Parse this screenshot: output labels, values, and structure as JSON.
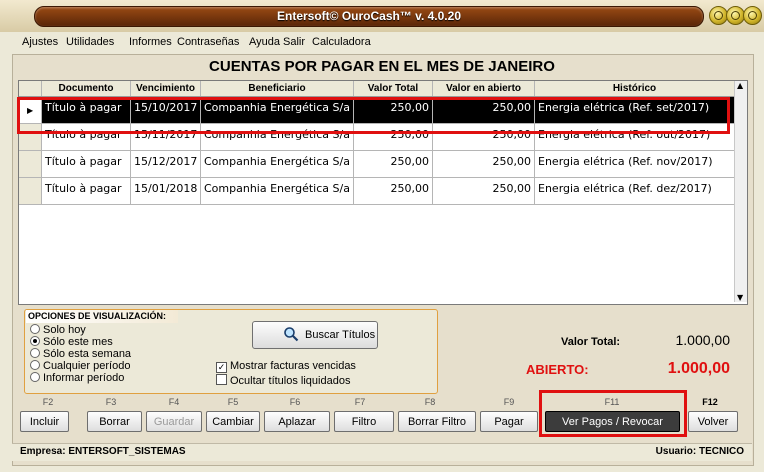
{
  "window": {
    "title": "Entersoft© OuroCash™ v. 4.0.20"
  },
  "menu": [
    "Ajustes",
    "Utilidades",
    "Informes",
    "Contraseñas",
    "Ayuda",
    "Salir",
    "Calculadora"
  ],
  "heading": "CUENTAS POR PAGAR EN EL MES DE JANEIRO",
  "table": {
    "columns": [
      "Documento",
      "Vencimiento",
      "Beneficiario",
      "Valor Total",
      "Valor en abierto",
      "Histórico"
    ],
    "rows": [
      {
        "documento": "Título à pagar",
        "vencimiento": "15/10/2017",
        "beneficiario": "Companhia Energética S/a",
        "valor_total": "250,00",
        "valor_abierto": "250,00",
        "historico": "Energia elétrica (Ref. set/2017)"
      },
      {
        "documento": "Título à pagar",
        "vencimiento": "15/11/2017",
        "beneficiario": "Companhia Energética S/a",
        "valor_total": "250,00",
        "valor_abierto": "250,00",
        "historico": "Energia elétrica (Ref. out/2017)"
      },
      {
        "documento": "Título à pagar",
        "vencimiento": "15/12/2017",
        "beneficiario": "Companhia Energética S/a",
        "valor_total": "250,00",
        "valor_abierto": "250,00",
        "historico": "Energia elétrica (Ref. nov/2017)"
      },
      {
        "documento": "Título à pagar",
        "vencimiento": "15/01/2018",
        "beneficiario": "Companhia Energética S/a",
        "valor_total": "250,00",
        "valor_abierto": "250,00",
        "historico": "Energia elétrica (Ref. dez/2017)"
      }
    ]
  },
  "options": {
    "label": "OPCIONES DE VISUALIZACIÓN:",
    "radios": [
      {
        "label": "Solo hoy",
        "checked": false
      },
      {
        "label": "Sólo este mes",
        "checked": true
      },
      {
        "label": "Sólo esta semana",
        "checked": false
      },
      {
        "label": "Cualquier período",
        "checked": false
      },
      {
        "label": "Informar período",
        "checked": false
      }
    ],
    "checkboxes": [
      {
        "label": "Mostrar facturas vencidas",
        "checked": true
      },
      {
        "label": "Ocultar títulos liquidados",
        "checked": false
      }
    ],
    "search_button": "Buscar Títulos"
  },
  "totals": {
    "total_label": "Valor Total:",
    "total_value": "1.000,00",
    "open_label": "ABIERTO:",
    "open_value": "1.000,00"
  },
  "toolbar": [
    {
      "key": "F2",
      "label": "Incluir",
      "disabled": false
    },
    {
      "key": "F3",
      "label": "Borrar",
      "disabled": false
    },
    {
      "key": "F4",
      "label": "Guardar",
      "disabled": true
    },
    {
      "key": "F5",
      "label": "Cambiar",
      "disabled": false
    },
    {
      "key": "F6",
      "label": "Aplazar",
      "disabled": false
    },
    {
      "key": "F7",
      "label": "Filtro",
      "disabled": false
    },
    {
      "key": "F8",
      "label": "Borrar Filtro",
      "disabled": false
    },
    {
      "key": "F9",
      "label": "Pagar",
      "disabled": false
    },
    {
      "key": "F11",
      "label": "Ver Pagos / Revocar",
      "disabled": false
    },
    {
      "key": "F12",
      "label": "Volver",
      "disabled": false
    }
  ],
  "status": {
    "empresa": "Empresa: ENTERSOFT_SISTEMAS",
    "usuario": "Usuario: TECNICO"
  },
  "colors": {
    "highlight": "#e01010",
    "selected_row": "#000000",
    "title_bar": "#7a3a0e"
  }
}
